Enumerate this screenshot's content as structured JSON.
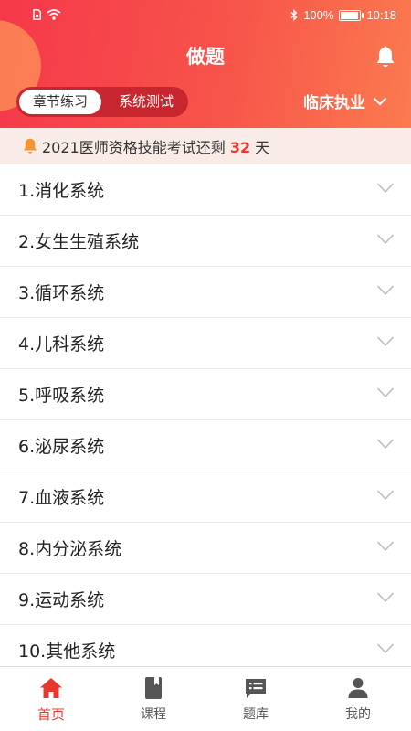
{
  "status_bar": {
    "battery": "100%",
    "time": "10:18"
  },
  "header": {
    "title": "做题"
  },
  "tabs": [
    {
      "label": "章节练习",
      "active": true
    },
    {
      "label": "系统测试",
      "active": false
    }
  ],
  "profession": {
    "label": "临床执业"
  },
  "notice": {
    "prefix": "2021医师资格技能考试还剩 ",
    "days": "32",
    "suffix": " 天"
  },
  "chapters": [
    {
      "label": "1.消化系统"
    },
    {
      "label": "2.女生生殖系统"
    },
    {
      "label": "3.循环系统"
    },
    {
      "label": "4.儿科系统"
    },
    {
      "label": "5.呼吸系统"
    },
    {
      "label": "6.泌尿系统"
    },
    {
      "label": "7.血液系统"
    },
    {
      "label": "8.内分泌系统"
    },
    {
      "label": "9.运动系统"
    },
    {
      "label": "10.其他系统"
    }
  ],
  "tabbar": [
    {
      "label": "首页",
      "icon": "home-icon",
      "active": true
    },
    {
      "label": "课程",
      "icon": "book-icon",
      "active": false
    },
    {
      "label": "题库",
      "icon": "question-bank-icon",
      "active": false
    },
    {
      "label": "我的",
      "icon": "user-icon",
      "active": false
    }
  ],
  "colors": {
    "accent": "#e8372f",
    "header_start": "#f5384a",
    "header_end": "#fb7b4f",
    "notice_bg": "#f9ece8"
  }
}
